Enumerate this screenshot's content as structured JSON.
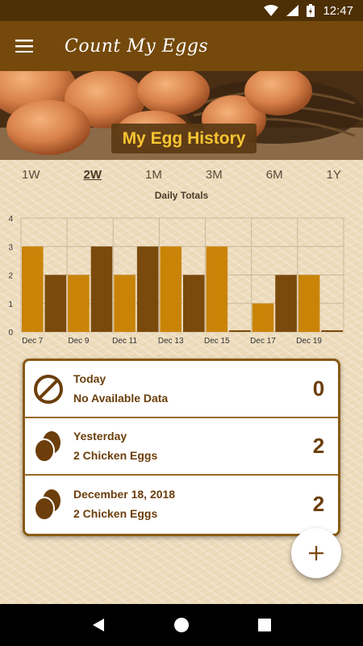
{
  "status_bar": {
    "time": "12:47"
  },
  "app_bar": {
    "title": "Count My Eggs"
  },
  "hero": {
    "title": "My Egg History"
  },
  "ranges": [
    "1W",
    "2W",
    "1M",
    "3M",
    "6M",
    "1Y"
  ],
  "active_range": "2W",
  "chart_title": "Daily Totals",
  "chart_data": {
    "type": "bar",
    "title": "Daily Totals",
    "categories": [
      "Dec 7",
      "Dec 8",
      "Dec 9",
      "Dec 10",
      "Dec 11",
      "Dec 12",
      "Dec 13",
      "Dec 14",
      "Dec 15",
      "Dec 16",
      "Dec 17",
      "Dec 18",
      "Dec 19",
      "Dec 20"
    ],
    "values": [
      3,
      2,
      2,
      3,
      2,
      3,
      3,
      2,
      3,
      0,
      1,
      2,
      2,
      0
    ],
    "tick_labels": [
      "Dec 7",
      "Dec 9",
      "Dec 11",
      "Dec 13",
      "Dec 15",
      "Dec 17",
      "Dec 19"
    ],
    "yticks": [
      0,
      1,
      2,
      3,
      4
    ],
    "ylim": [
      0,
      4
    ],
    "grid": true,
    "colors": {
      "light": "#c98408",
      "dark": "#7a4a0c"
    }
  },
  "entries": [
    {
      "title": "Today",
      "subtitle": "No Available Data",
      "count": "0",
      "icon": "no-data-icon"
    },
    {
      "title": "Yesterday",
      "subtitle": "2 Chicken Eggs",
      "count": "2",
      "icon": "eggs-icon"
    },
    {
      "title": "December 18, 2018",
      "subtitle": "2 Chicken Eggs",
      "count": "2",
      "icon": "eggs-icon"
    }
  ],
  "fab": {
    "label": "+"
  },
  "colors": {
    "app_bar": "#74490b",
    "status_bar": "#4d2f06",
    "accent": "#6b3e0b",
    "hero_title": "#f7c531"
  }
}
